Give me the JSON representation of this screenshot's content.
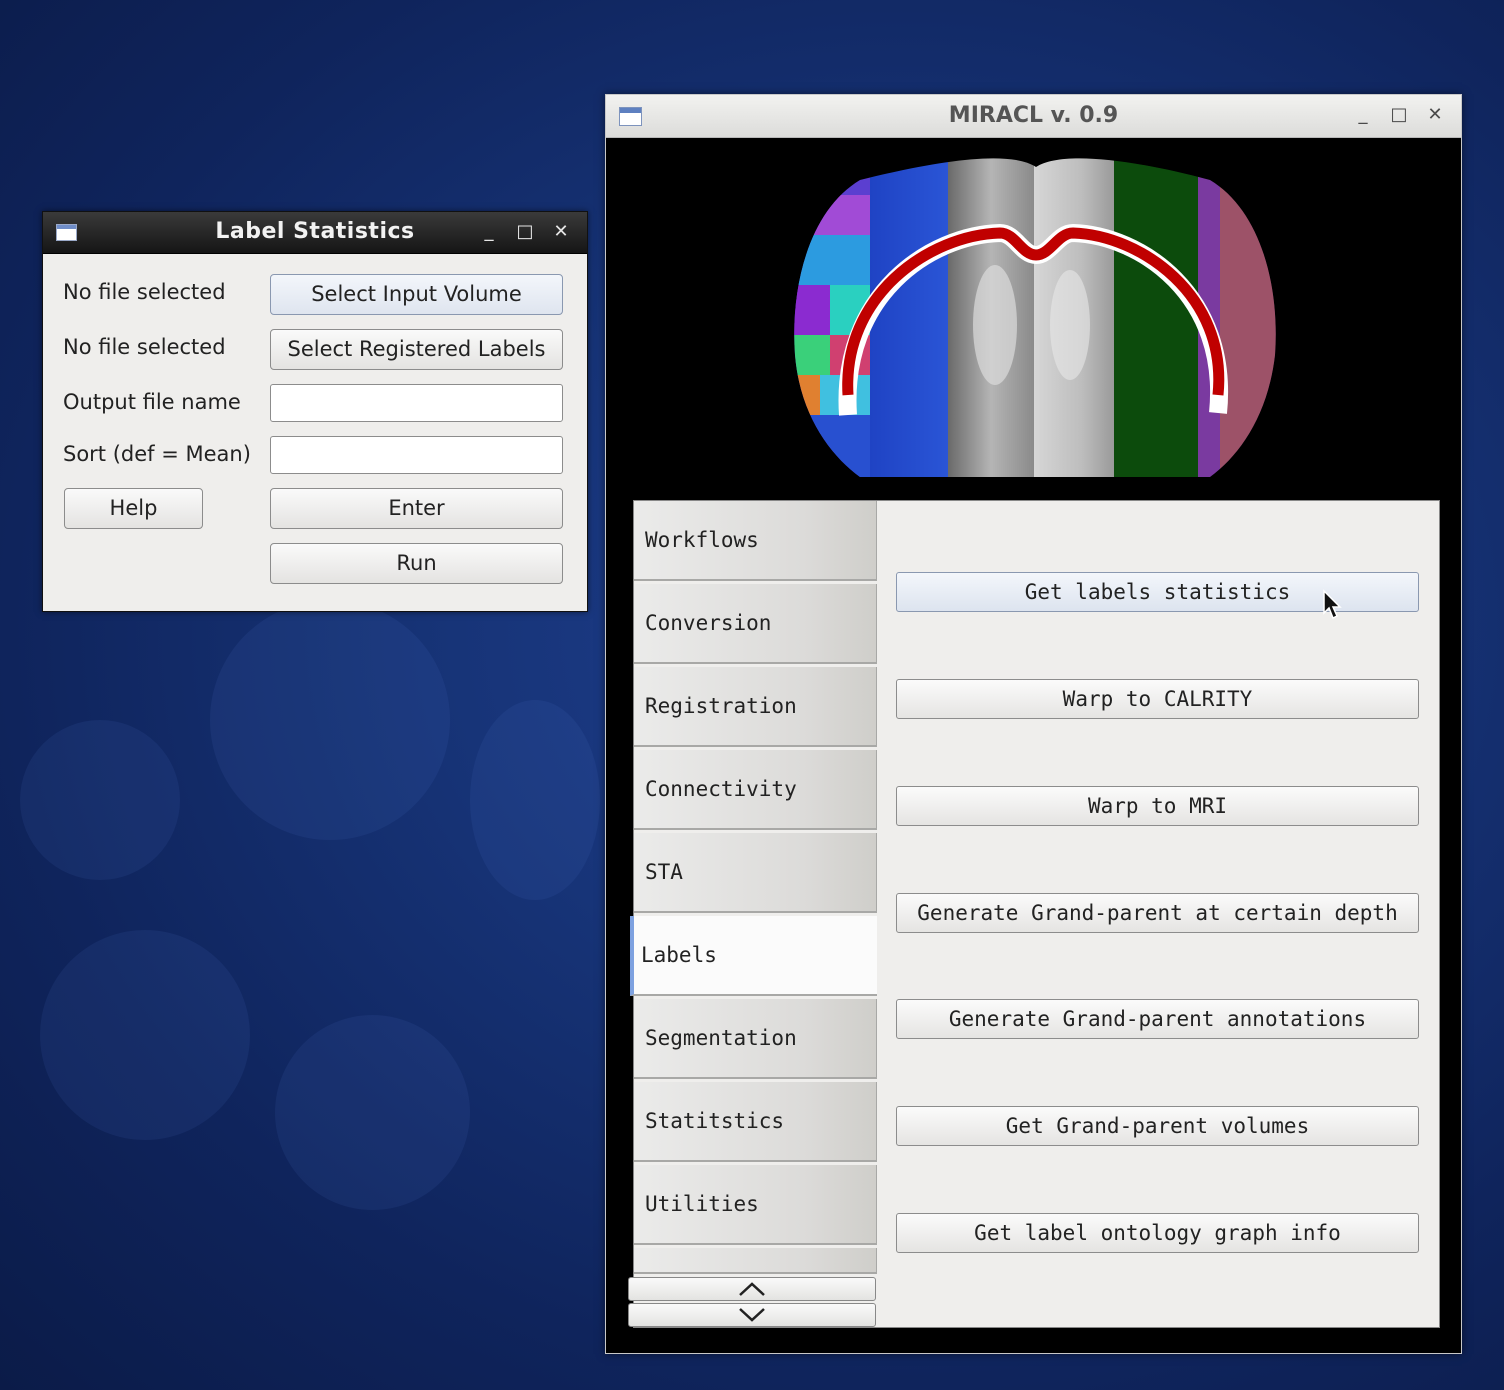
{
  "label_statistics_window": {
    "title": "Label Statistics",
    "controls": {
      "minimize": "_",
      "maximize": "□",
      "close": "✕"
    },
    "rows": [
      {
        "label": "No file selected",
        "button": "Select Input Volume"
      },
      {
        "label": "No file selected",
        "button": "Select Registered Labels"
      },
      {
        "label": "Output file name",
        "input_value": ""
      },
      {
        "label": "Sort (def = Mean)",
        "input_value": ""
      }
    ],
    "help_button": "Help",
    "enter_button": "Enter",
    "run_button": "Run"
  },
  "miracl_window": {
    "title": "MIRACL v. 0.9",
    "controls": {
      "minimize": "_",
      "maximize": "□",
      "close": "✕"
    },
    "tabs": [
      "Workflows",
      "Conversion",
      "Registration",
      "Connectivity",
      "STA",
      "Labels",
      "Segmentation",
      "Statitstics",
      "Utilities"
    ],
    "active_tab": "Labels",
    "buttons": [
      "Get labels statistics",
      "Warp to CALRITY",
      "Warp to MRI",
      "Generate Grand-parent at certain depth",
      "Generate Grand-parent annotations",
      "Get Grand-parent volumes",
      "Get label ontology graph info"
    ],
    "scroll_up_icon": "chevron-up-icon",
    "scroll_down_icon": "chevron-down-icon"
  },
  "colors": {
    "desktop": "#173478",
    "window_bg": "#efeeec",
    "dark_titlebar": "#1f1f1f",
    "active_tab_accent": "#7da1e0",
    "brain_tract": "#c00000"
  }
}
